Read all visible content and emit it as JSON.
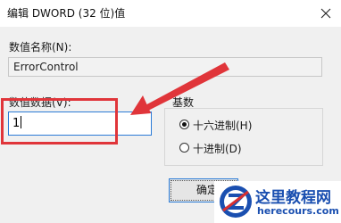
{
  "window": {
    "title": "编辑 DWORD (32 位)值",
    "close_icon": "close-icon"
  },
  "form": {
    "name_label": "数值名称(N):",
    "name_value": "ErrorControl",
    "data_label": "数值数据(V):",
    "data_value": "1"
  },
  "base": {
    "group_label": "基数",
    "options": [
      {
        "label": "十六进制(H)",
        "selected": true
      },
      {
        "label": "十进制(D)",
        "selected": false
      }
    ]
  },
  "buttons": {
    "ok_label": "确定"
  },
  "annotation": {
    "highlight_color": "#e0353a",
    "arrow_color": "#e0353a"
  },
  "watermark": {
    "title": "这里教程网",
    "url": "herecours.com",
    "logo_icon": "z-logo-icon"
  }
}
